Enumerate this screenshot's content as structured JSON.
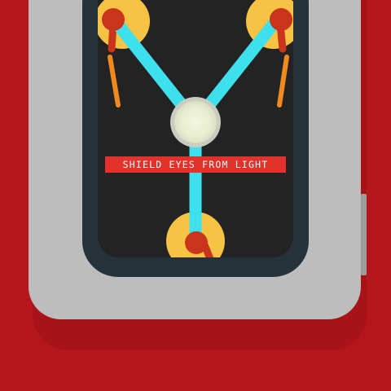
{
  "device": {
    "name": "flux-capacitor",
    "warning_label": "SHIELD EYES FROM LIGHT"
  },
  "colors": {
    "background": "#b5161b",
    "casing": "#bdbdbd",
    "frame": "#25323a",
    "chamber": "#232323",
    "mount": "#f6c344",
    "electrode": "#c9341c",
    "lead": "#f08a1d",
    "tube": "#3fe0ee",
    "core": "#eef2dc",
    "label_bg": "#e2322b",
    "label_text": "#ffffff"
  }
}
